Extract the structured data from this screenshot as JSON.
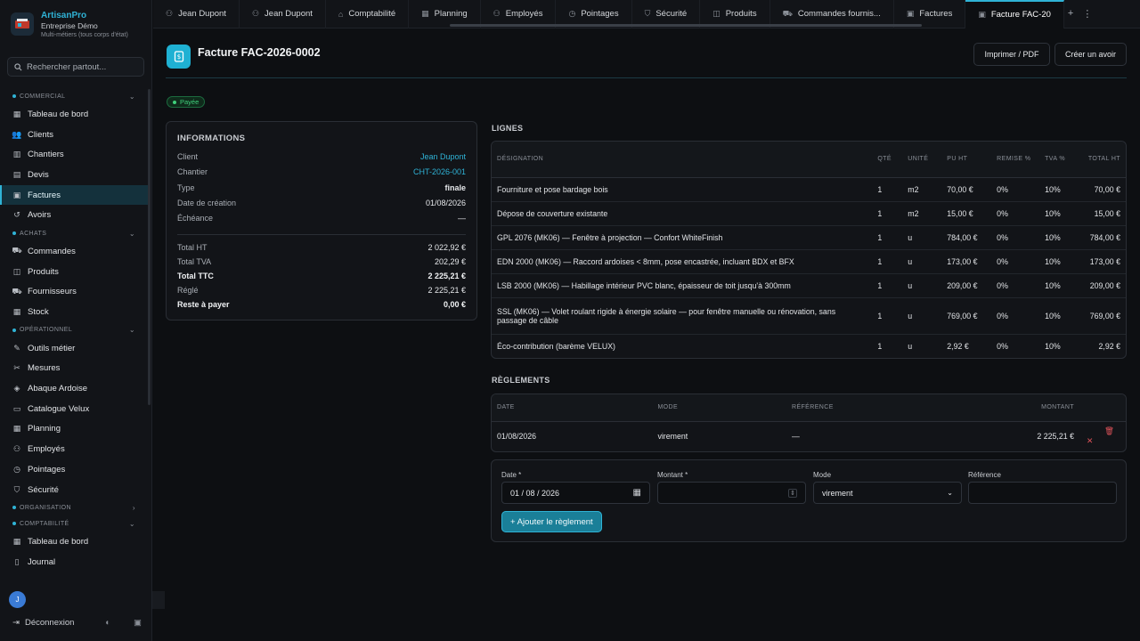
{
  "brand": {
    "name": "ArtisanPro",
    "company": "Entreprise Démo",
    "subtitle": "Multi-métiers (tous corps d'état)"
  },
  "search": {
    "placeholder": "Rechercher partout..."
  },
  "sidebar": {
    "sections": [
      {
        "label": "COMMERCIAL",
        "chevron": "chevron-down",
        "items": [
          {
            "label": "Tableau de bord",
            "icon": "dashboard-icon"
          },
          {
            "label": "Clients",
            "icon": "users-icon"
          },
          {
            "label": "Chantiers",
            "icon": "building-icon"
          },
          {
            "label": "Devis",
            "icon": "document-icon"
          },
          {
            "label": "Factures",
            "icon": "invoice-icon",
            "active": true
          },
          {
            "label": "Avoirs",
            "icon": "undo-icon"
          }
        ]
      },
      {
        "label": "ACHATS",
        "chevron": "chevron-down",
        "items": [
          {
            "label": "Commandes",
            "icon": "cart-icon"
          },
          {
            "label": "Produits",
            "icon": "box-icon"
          },
          {
            "label": "Fournisseurs",
            "icon": "truck-icon"
          },
          {
            "label": "Stock",
            "icon": "warehouse-icon"
          }
        ]
      },
      {
        "label": "OPÉRATIONNEL",
        "chevron": "chevron-down",
        "items": [
          {
            "label": "Outils métier",
            "icon": "wrench-icon"
          },
          {
            "label": "Mesures",
            "icon": "ruler-icon"
          },
          {
            "label": "Abaque Ardoise",
            "icon": "slate-icon"
          },
          {
            "label": "Catalogue Velux",
            "icon": "window-icon"
          },
          {
            "label": "Planning",
            "icon": "calendar-icon"
          },
          {
            "label": "Employés",
            "icon": "team-icon"
          },
          {
            "label": "Pointages",
            "icon": "clock-icon"
          },
          {
            "label": "Sécurité",
            "icon": "shield-icon"
          }
        ]
      },
      {
        "label": "ORGANISATION",
        "chevron": "chevron-right",
        "items": []
      },
      {
        "label": "COMPTABILITÉ",
        "chevron": "chevron-down",
        "items": [
          {
            "label": "Tableau de bord",
            "icon": "dashboard-icon"
          },
          {
            "label": "Journal",
            "icon": "book-icon"
          }
        ]
      }
    ],
    "user_initial": "J",
    "logout_label": "Déconnexion"
  },
  "tabs": [
    {
      "label": "Jean Dupont",
      "icon": "user-icon"
    },
    {
      "label": "Jean Dupont",
      "icon": "user-icon"
    },
    {
      "label": "Comptabilité",
      "icon": "bank-icon"
    },
    {
      "label": "Planning",
      "icon": "calendar-icon"
    },
    {
      "label": "Employés",
      "icon": "team-icon"
    },
    {
      "label": "Pointages",
      "icon": "clock-icon"
    },
    {
      "label": "Sécurité",
      "icon": "shield-icon"
    },
    {
      "label": "Produits",
      "icon": "box-icon"
    },
    {
      "label": "Commandes fournis...",
      "icon": "cart-icon"
    },
    {
      "label": "Factures",
      "icon": "invoice-icon"
    },
    {
      "label": "Facture FAC-20",
      "icon": "invoice-icon",
      "active": true
    }
  ],
  "page": {
    "title": "Facture FAC-2026-0002",
    "print_label": "Imprimer / PDF",
    "credit_label": "Créer un avoir",
    "status": "Payée"
  },
  "info": {
    "title": "INFORMATIONS",
    "rows": [
      {
        "k": "Client",
        "v": "Jean Dupont",
        "link": true
      },
      {
        "k": "Chantier",
        "v": "CHT-2026-001",
        "link": true
      },
      {
        "k": "Type",
        "v": "finale",
        "strong": true
      },
      {
        "k": "Date de création",
        "v": "01/08/2026"
      },
      {
        "k": "Échéance",
        "v": "—"
      }
    ],
    "totals": [
      {
        "k": "Total HT",
        "v": "2 022,92 €"
      },
      {
        "k": "Total TVA",
        "v": "202,29 €"
      },
      {
        "k": "Total TTC",
        "v": "2 225,21 €",
        "bold": true
      },
      {
        "k": "Réglé",
        "v": "2 225,21 €"
      },
      {
        "k": "Reste à payer",
        "v": "0,00 €",
        "bold": true
      }
    ]
  },
  "lines": {
    "title": "LIGNES",
    "headers": [
      "DÉSIGNATION",
      "QTÉ",
      "UNITÉ",
      "PU HT",
      "REMISE %",
      "TVA %",
      "TOTAL HT"
    ],
    "rows": [
      [
        "Fourniture et pose bardage bois",
        "1",
        "m2",
        "70,00 €",
        "0%",
        "10%",
        "70,00 €"
      ],
      [
        "Dépose de couverture existante",
        "1",
        "m2",
        "15,00 €",
        "0%",
        "10%",
        "15,00 €"
      ],
      [
        "GPL 2076 (MK06) — Fenêtre à projection — Confort WhiteFinish",
        "1",
        "u",
        "784,00 €",
        "0%",
        "10%",
        "784,00 €"
      ],
      [
        "EDN 2000 (MK06) — Raccord ardoises < 8mm, pose encastrée, incluant BDX et BFX",
        "1",
        "u",
        "173,00 €",
        "0%",
        "10%",
        "173,00 €"
      ],
      [
        "LSB 2000 (MK06) — Habillage intérieur PVC blanc, épaisseur de toit jusqu'à 300mm",
        "1",
        "u",
        "209,00 €",
        "0%",
        "10%",
        "209,00 €"
      ],
      [
        "SSL (MK06) — Volet roulant rigide à énergie solaire — pour fenêtre manuelle ou rénovation, sans passage de câble",
        "1",
        "u",
        "769,00 €",
        "0%",
        "10%",
        "769,00 €"
      ],
      [
        "Éco-contribution (barème VELUX)",
        "1",
        "u",
        "2,92 €",
        "0%",
        "10%",
        "2,92 €"
      ]
    ]
  },
  "payments": {
    "title": "RÈGLEMENTS",
    "headers": [
      "DATE",
      "MODE",
      "RÉFÉRENCE",
      "MONTANT"
    ],
    "rows": [
      [
        "01/08/2026",
        "virement",
        "—",
        "2 225,21 €"
      ]
    ]
  },
  "form": {
    "date_label": "Date *",
    "date_value": "01 / 08 / 2026",
    "amount_label": "Montant *",
    "amount_value": "",
    "mode_label": "Mode",
    "mode_value": "virement",
    "ref_label": "Référence",
    "ref_value": "",
    "submit_label": "+ Ajouter le règlement"
  }
}
